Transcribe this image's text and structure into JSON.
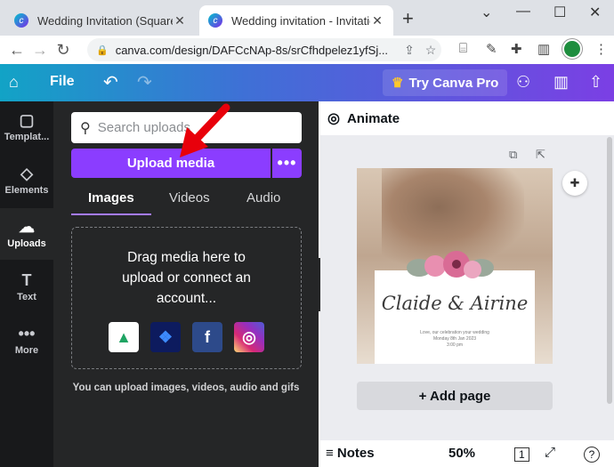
{
  "browser": {
    "tabs": [
      {
        "title": "Wedding Invitation (Square)",
        "close": "✕"
      },
      {
        "title": "Wedding invitation - Invitation (",
        "close": "✕"
      }
    ],
    "new_tab": "+",
    "window_controls": {
      "chevron": "⌄",
      "minimize": "—",
      "maximize": "☐",
      "close": "✕"
    },
    "url": "canva.com/design/DAFCcNAp-8s/srCfhdpelez1yfSj..."
  },
  "header": {
    "file_label": "File",
    "pro_label": "Try Canva Pro"
  },
  "side_rail": {
    "items": [
      {
        "label": "Templat...",
        "icon": "▢"
      },
      {
        "label": "Elements",
        "icon": "◇"
      },
      {
        "label": "Uploads",
        "icon": "☁"
      },
      {
        "label": "Text",
        "icon": "T"
      },
      {
        "label": "More",
        "icon": "•••"
      }
    ]
  },
  "uploads_panel": {
    "search_placeholder": "Search uploads",
    "upload_button": "Upload media",
    "more_button": "•••",
    "tabs": [
      "Images",
      "Videos",
      "Audio"
    ],
    "drop_text": "Drag media here to upload or connect an account...",
    "sources": [
      {
        "name": "google-drive",
        "glyph": "▲",
        "color": "#ffffff"
      },
      {
        "name": "dropbox",
        "glyph": "❖",
        "color": "#0d1b5e"
      },
      {
        "name": "facebook",
        "glyph": "f",
        "color": "#2d4a8a"
      },
      {
        "name": "instagram",
        "glyph": "◎",
        "color": "#d6249f"
      }
    ],
    "hint": "You can upload images, videos, audio and gifs"
  },
  "editor": {
    "animate_label": "Animate",
    "design": {
      "names": "Claide & Airine",
      "details": [
        "Love, our celebration your wedding",
        "Monday 8th Jan 2023",
        "3:00 pm"
      ]
    },
    "add_page_label": "+ Add page",
    "notes_label": "Notes",
    "zoom": "50%",
    "page_count": "1",
    "help": "?"
  },
  "colors": {
    "accent": "#8b3dff",
    "rail_bg": "#18191b",
    "panel_bg": "#252627",
    "arrow": "#e8000b"
  }
}
